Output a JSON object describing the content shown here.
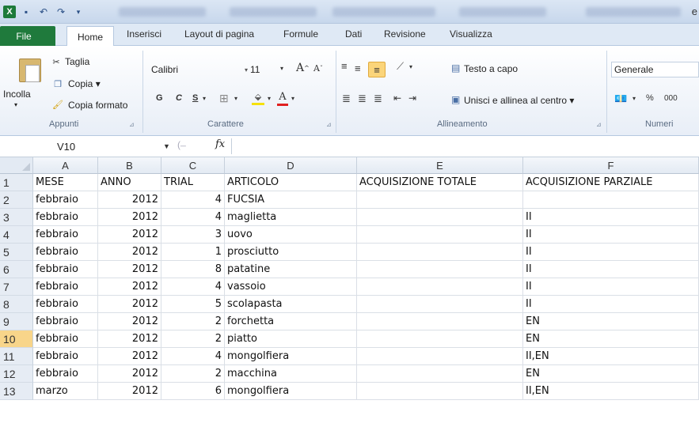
{
  "titlebar": {
    "app_icon": "excel-icon",
    "save_icon": "save-icon",
    "undo_icon": "undo-icon",
    "redo_icon": "redo-icon",
    "trailing_char": "e"
  },
  "ribbon_tabs": [
    "File",
    "Home",
    "Inserisci",
    "Layout di pagina",
    "Formule",
    "Dati",
    "Revisione",
    "Visualizza"
  ],
  "clipboard": {
    "paste_label": "Incolla",
    "cut_label": "Taglia",
    "copy_label": "Copia ▾",
    "format_painter_label": "Copia formato",
    "group_label": "Appunti"
  },
  "font": {
    "font_name": "Calibri",
    "font_size": "11",
    "bold": "G",
    "italic": "C",
    "underline": "S",
    "group_label": "Carattere"
  },
  "alignment": {
    "wrap_text_label": "Testo a capo",
    "merge_center_label": "Unisci e allinea al centro ▾",
    "group_label": "Allineamento"
  },
  "number": {
    "format_value": "Generale",
    "percent": "%",
    "thousands": "000",
    "group_label": "Numeri"
  },
  "formula_bar": {
    "name_box": "V10",
    "fx_label": "fx",
    "formula": ""
  },
  "columns": [
    "A",
    "B",
    "C",
    "D",
    "E",
    "F"
  ],
  "active_row": 10,
  "rows": [
    {
      "num": "1",
      "cells": [
        "MESE",
        "ANNO",
        "TRIAL",
        "ARTICOLO",
        "ACQUISIZIONE TOTALE",
        "ACQUISIZIONE PARZIALE"
      ]
    },
    {
      "num": "2",
      "cells": [
        "febbraio",
        "2012",
        "4",
        "FUCSIA",
        "",
        ""
      ]
    },
    {
      "num": "3",
      "cells": [
        "febbraio",
        "2012",
        "4",
        "maglietta",
        "",
        "II"
      ]
    },
    {
      "num": "4",
      "cells": [
        "febbraio",
        "2012",
        "3",
        "uovo",
        "",
        "II"
      ]
    },
    {
      "num": "5",
      "cells": [
        "febbraio",
        "2012",
        "1",
        "prosciutto",
        "",
        "II"
      ]
    },
    {
      "num": "6",
      "cells": [
        "febbraio",
        "2012",
        "8",
        "patatine",
        "",
        "II"
      ]
    },
    {
      "num": "7",
      "cells": [
        "febbraio",
        "2012",
        "4",
        "vassoio",
        "",
        "II"
      ]
    },
    {
      "num": "8",
      "cells": [
        "febbraio",
        "2012",
        "5",
        "scolapasta",
        "",
        "II"
      ]
    },
    {
      "num": "9",
      "cells": [
        "febbraio",
        "2012",
        "2",
        "forchetta",
        "",
        "EN"
      ]
    },
    {
      "num": "10",
      "cells": [
        "febbraio",
        "2012",
        "2",
        "piatto",
        "",
        "EN"
      ]
    },
    {
      "num": "11",
      "cells": [
        "febbraio",
        "2012",
        "4",
        "mongolfiera",
        "",
        "II,EN"
      ]
    },
    {
      "num": "12",
      "cells": [
        "febbraio",
        "2012",
        "2",
        "macchina",
        "",
        "EN"
      ]
    },
    {
      "num": "13",
      "cells": [
        "marzo",
        "2012",
        "6",
        "mongolfiera",
        "",
        "II,EN"
      ]
    }
  ]
}
